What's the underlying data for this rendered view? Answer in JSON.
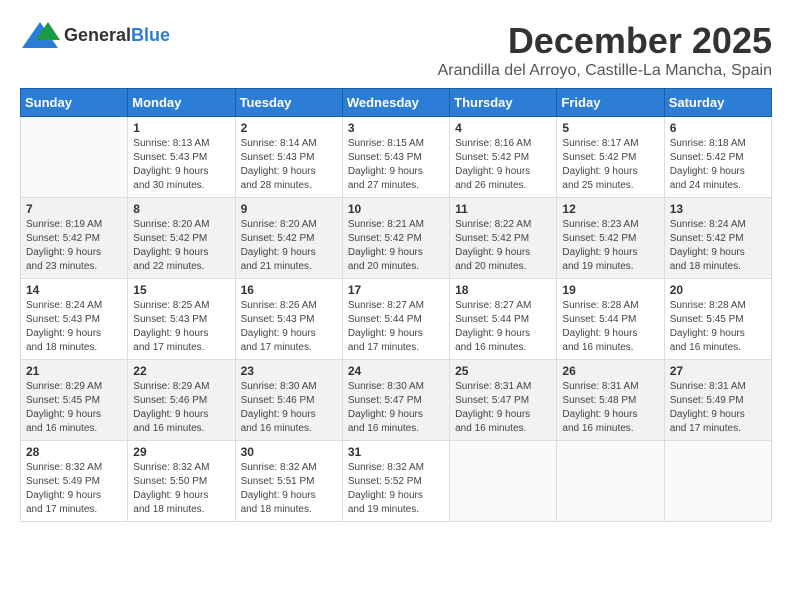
{
  "logo": {
    "general": "General",
    "blue": "Blue"
  },
  "title": "December 2025",
  "location": "Arandilla del Arroyo, Castille-La Mancha, Spain",
  "days_of_week": [
    "Sunday",
    "Monday",
    "Tuesday",
    "Wednesday",
    "Thursday",
    "Friday",
    "Saturday"
  ],
  "weeks": [
    [
      {
        "num": "",
        "info": ""
      },
      {
        "num": "1",
        "info": "Sunrise: 8:13 AM\nSunset: 5:43 PM\nDaylight: 9 hours\nand 30 minutes."
      },
      {
        "num": "2",
        "info": "Sunrise: 8:14 AM\nSunset: 5:43 PM\nDaylight: 9 hours\nand 28 minutes."
      },
      {
        "num": "3",
        "info": "Sunrise: 8:15 AM\nSunset: 5:43 PM\nDaylight: 9 hours\nand 27 minutes."
      },
      {
        "num": "4",
        "info": "Sunrise: 8:16 AM\nSunset: 5:42 PM\nDaylight: 9 hours\nand 26 minutes."
      },
      {
        "num": "5",
        "info": "Sunrise: 8:17 AM\nSunset: 5:42 PM\nDaylight: 9 hours\nand 25 minutes."
      },
      {
        "num": "6",
        "info": "Sunrise: 8:18 AM\nSunset: 5:42 PM\nDaylight: 9 hours\nand 24 minutes."
      }
    ],
    [
      {
        "num": "7",
        "info": "Sunrise: 8:19 AM\nSunset: 5:42 PM\nDaylight: 9 hours\nand 23 minutes."
      },
      {
        "num": "8",
        "info": "Sunrise: 8:20 AM\nSunset: 5:42 PM\nDaylight: 9 hours\nand 22 minutes."
      },
      {
        "num": "9",
        "info": "Sunrise: 8:20 AM\nSunset: 5:42 PM\nDaylight: 9 hours\nand 21 minutes."
      },
      {
        "num": "10",
        "info": "Sunrise: 8:21 AM\nSunset: 5:42 PM\nDaylight: 9 hours\nand 20 minutes."
      },
      {
        "num": "11",
        "info": "Sunrise: 8:22 AM\nSunset: 5:42 PM\nDaylight: 9 hours\nand 20 minutes."
      },
      {
        "num": "12",
        "info": "Sunrise: 8:23 AM\nSunset: 5:42 PM\nDaylight: 9 hours\nand 19 minutes."
      },
      {
        "num": "13",
        "info": "Sunrise: 8:24 AM\nSunset: 5:42 PM\nDaylight: 9 hours\nand 18 minutes."
      }
    ],
    [
      {
        "num": "14",
        "info": "Sunrise: 8:24 AM\nSunset: 5:43 PM\nDaylight: 9 hours\nand 18 minutes."
      },
      {
        "num": "15",
        "info": "Sunrise: 8:25 AM\nSunset: 5:43 PM\nDaylight: 9 hours\nand 17 minutes."
      },
      {
        "num": "16",
        "info": "Sunrise: 8:26 AM\nSunset: 5:43 PM\nDaylight: 9 hours\nand 17 minutes."
      },
      {
        "num": "17",
        "info": "Sunrise: 8:27 AM\nSunset: 5:44 PM\nDaylight: 9 hours\nand 17 minutes."
      },
      {
        "num": "18",
        "info": "Sunrise: 8:27 AM\nSunset: 5:44 PM\nDaylight: 9 hours\nand 16 minutes."
      },
      {
        "num": "19",
        "info": "Sunrise: 8:28 AM\nSunset: 5:44 PM\nDaylight: 9 hours\nand 16 minutes."
      },
      {
        "num": "20",
        "info": "Sunrise: 8:28 AM\nSunset: 5:45 PM\nDaylight: 9 hours\nand 16 minutes."
      }
    ],
    [
      {
        "num": "21",
        "info": "Sunrise: 8:29 AM\nSunset: 5:45 PM\nDaylight: 9 hours\nand 16 minutes."
      },
      {
        "num": "22",
        "info": "Sunrise: 8:29 AM\nSunset: 5:46 PM\nDaylight: 9 hours\nand 16 minutes."
      },
      {
        "num": "23",
        "info": "Sunrise: 8:30 AM\nSunset: 5:46 PM\nDaylight: 9 hours\nand 16 minutes."
      },
      {
        "num": "24",
        "info": "Sunrise: 8:30 AM\nSunset: 5:47 PM\nDaylight: 9 hours\nand 16 minutes."
      },
      {
        "num": "25",
        "info": "Sunrise: 8:31 AM\nSunset: 5:47 PM\nDaylight: 9 hours\nand 16 minutes."
      },
      {
        "num": "26",
        "info": "Sunrise: 8:31 AM\nSunset: 5:48 PM\nDaylight: 9 hours\nand 16 minutes."
      },
      {
        "num": "27",
        "info": "Sunrise: 8:31 AM\nSunset: 5:49 PM\nDaylight: 9 hours\nand 17 minutes."
      }
    ],
    [
      {
        "num": "28",
        "info": "Sunrise: 8:32 AM\nSunset: 5:49 PM\nDaylight: 9 hours\nand 17 minutes."
      },
      {
        "num": "29",
        "info": "Sunrise: 8:32 AM\nSunset: 5:50 PM\nDaylight: 9 hours\nand 18 minutes."
      },
      {
        "num": "30",
        "info": "Sunrise: 8:32 AM\nSunset: 5:51 PM\nDaylight: 9 hours\nand 18 minutes."
      },
      {
        "num": "31",
        "info": "Sunrise: 8:32 AM\nSunset: 5:52 PM\nDaylight: 9 hours\nand 19 minutes."
      },
      {
        "num": "",
        "info": ""
      },
      {
        "num": "",
        "info": ""
      },
      {
        "num": "",
        "info": ""
      }
    ]
  ]
}
